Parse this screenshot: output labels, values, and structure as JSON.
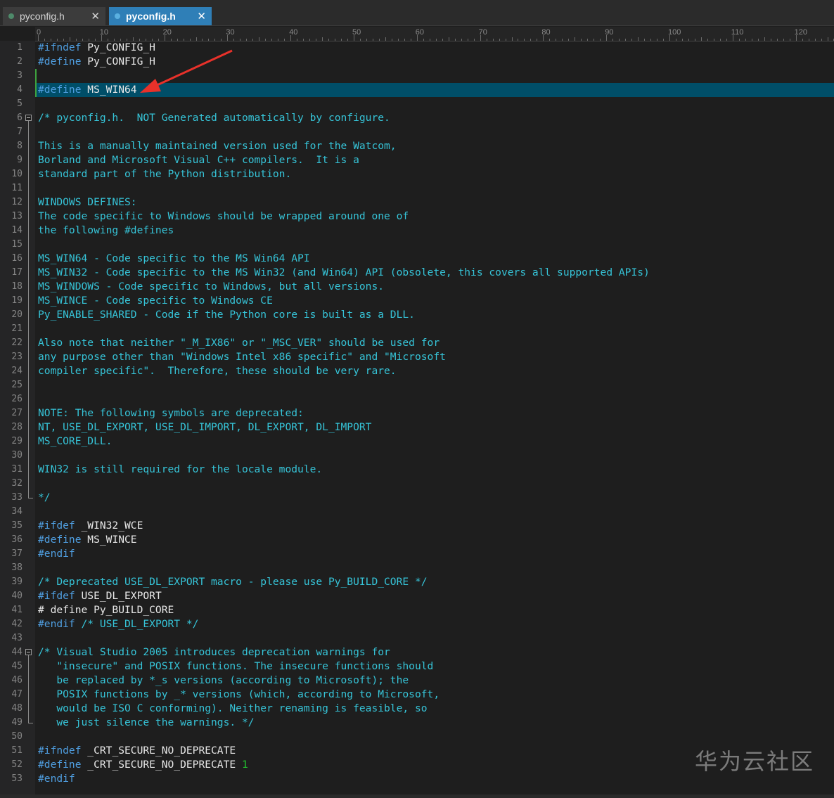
{
  "tabs": [
    {
      "label": "pyconfig.h",
      "close": "✕",
      "active": false
    },
    {
      "label": "pyconfig.h",
      "close": "✕",
      "active": true
    }
  ],
  "ruler_labels": [
    "0",
    "10",
    "20",
    "30",
    "40",
    "50",
    "60",
    "70",
    "80",
    "90",
    "100",
    "110",
    "120"
  ],
  "lines": [
    [
      {
        "t": "kw",
        "v": "#ifndef"
      },
      {
        "t": "id",
        "v": " Py_CONFIG_H"
      }
    ],
    [
      {
        "t": "kw",
        "v": "#define"
      },
      {
        "t": "id",
        "v": " Py_CONFIG_H"
      }
    ],
    [],
    [
      {
        "t": "kw",
        "v": "#define"
      },
      {
        "t": "id",
        "v": " MS_WIN64"
      }
    ],
    [],
    [
      {
        "t": "cm",
        "v": "/* pyconfig.h.  NOT Generated automatically by configure."
      }
    ],
    [],
    [
      {
        "t": "cm",
        "v": "This is a manually maintained version used for the Watcom,"
      }
    ],
    [
      {
        "t": "cm",
        "v": "Borland and Microsoft Visual C++ compilers.  It is a"
      }
    ],
    [
      {
        "t": "cm",
        "v": "standard part of the Python distribution."
      }
    ],
    [],
    [
      {
        "t": "cm",
        "v": "WINDOWS DEFINES:"
      }
    ],
    [
      {
        "t": "cm",
        "v": "The code specific to Windows should be wrapped around one of"
      }
    ],
    [
      {
        "t": "cm",
        "v": "the following #defines"
      }
    ],
    [],
    [
      {
        "t": "cm",
        "v": "MS_WIN64 - Code specific to the MS Win64 API"
      }
    ],
    [
      {
        "t": "cm",
        "v": "MS_WIN32 - Code specific to the MS Win32 (and Win64) API (obsolete, this covers all supported APIs)"
      }
    ],
    [
      {
        "t": "cm",
        "v": "MS_WINDOWS - Code specific to Windows, but all versions."
      }
    ],
    [
      {
        "t": "cm",
        "v": "MS_WINCE - Code specific to Windows CE"
      }
    ],
    [
      {
        "t": "cm",
        "v": "Py_ENABLE_SHARED - Code if the Python core is built as a DLL."
      }
    ],
    [],
    [
      {
        "t": "cm",
        "v": "Also note that neither \"_M_IX86\" or \"_MSC_VER\" should be used for"
      }
    ],
    [
      {
        "t": "cm",
        "v": "any purpose other than \"Windows Intel x86 specific\" and \"Microsoft"
      }
    ],
    [
      {
        "t": "cm",
        "v": "compiler specific\".  Therefore, these should be very rare."
      }
    ],
    [],
    [],
    [
      {
        "t": "cm",
        "v": "NOTE: The following symbols are deprecated:"
      }
    ],
    [
      {
        "t": "cm",
        "v": "NT, USE_DL_EXPORT, USE_DL_IMPORT, DL_EXPORT, DL_IMPORT"
      }
    ],
    [
      {
        "t": "cm",
        "v": "MS_CORE_DLL."
      }
    ],
    [],
    [
      {
        "t": "cm",
        "v": "WIN32 is still required for the locale module."
      }
    ],
    [],
    [
      {
        "t": "cm",
        "v": "*/"
      }
    ],
    [],
    [
      {
        "t": "kw",
        "v": "#ifdef"
      },
      {
        "t": "id",
        "v": " _WIN32_WCE"
      }
    ],
    [
      {
        "t": "kw",
        "v": "#define"
      },
      {
        "t": "id",
        "v": " MS_WINCE"
      }
    ],
    [
      {
        "t": "kw",
        "v": "#endif"
      }
    ],
    [],
    [
      {
        "t": "cm",
        "v": "/* Deprecated USE_DL_EXPORT macro - please use Py_BUILD_CORE */"
      }
    ],
    [
      {
        "t": "kw",
        "v": "#ifdef"
      },
      {
        "t": "id",
        "v": " USE_DL_EXPORT"
      }
    ],
    [
      {
        "t": "id",
        "v": "# define Py_BUILD_CORE"
      }
    ],
    [
      {
        "t": "kw",
        "v": "#endif"
      },
      {
        "t": "cm",
        "v": " /* USE_DL_EXPORT */"
      }
    ],
    [],
    [
      {
        "t": "cm",
        "v": "/* Visual Studio 2005 introduces deprecation warnings for"
      }
    ],
    [
      {
        "t": "cm",
        "v": "   \"insecure\" and POSIX functions. The insecure functions should"
      }
    ],
    [
      {
        "t": "cm",
        "v": "   be replaced by *_s versions (according to Microsoft); the"
      }
    ],
    [
      {
        "t": "cm",
        "v": "   POSIX functions by _* versions (which, according to Microsoft,"
      }
    ],
    [
      {
        "t": "cm",
        "v": "   would be ISO C conforming). Neither renaming is feasible, so"
      }
    ],
    [
      {
        "t": "cm",
        "v": "   we just silence the warnings. */"
      }
    ],
    [],
    [
      {
        "t": "kw",
        "v": "#ifndef"
      },
      {
        "t": "id",
        "v": " _CRT_SECURE_NO_DEPRECATE"
      }
    ],
    [
      {
        "t": "kw",
        "v": "#define"
      },
      {
        "t": "id",
        "v": " _CRT_SECURE_NO_DEPRECATE "
      },
      {
        "t": "num",
        "v": "1"
      }
    ],
    [
      {
        "t": "kw",
        "v": "#endif"
      }
    ]
  ],
  "highlighted_line": 4,
  "watermark": "华为云社区"
}
